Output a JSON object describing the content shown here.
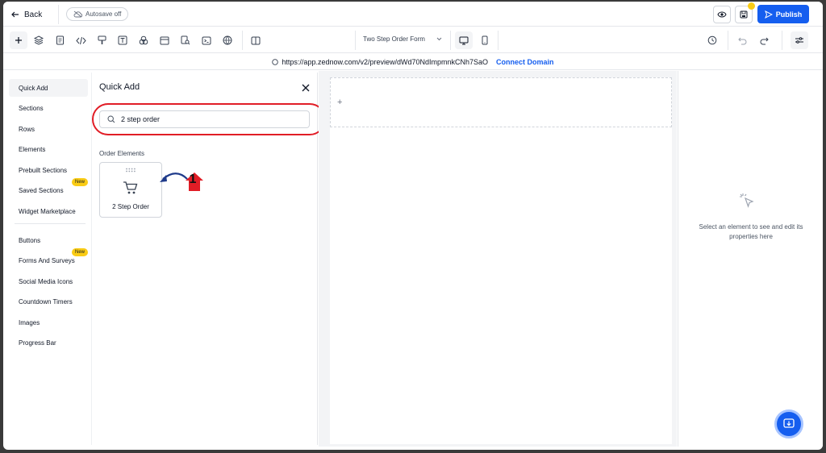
{
  "topbar": {
    "back_label": "Back",
    "autosave_label": "Autosave off",
    "publish_label": "Publish"
  },
  "toolbar": {
    "tools": [
      "plus-icon",
      "layers-icon",
      "page-icon",
      "code-icon",
      "paint-icon",
      "text-icon",
      "shapes-icon",
      "window-icon",
      "search-doc-icon",
      "terminal-icon",
      "globe-icon",
      "split-icon"
    ],
    "page_selector": "Two Step Order Form",
    "devices": [
      "desktop-icon",
      "mobile-icon"
    ]
  },
  "urlbar": {
    "url": "https://app.zednow.com/v2/preview/dWd70NdImpmnkCNh7SaO",
    "connect_label": "Connect Domain"
  },
  "sidebar": {
    "items": [
      {
        "label": "Quick Add",
        "active": true
      },
      {
        "label": "Sections"
      },
      {
        "label": "Rows"
      },
      {
        "label": "Elements"
      },
      {
        "label": "Prebuilt Sections"
      },
      {
        "label": "Saved Sections",
        "badge": "New"
      },
      {
        "label": "Widget Marketplace"
      },
      {
        "label": "Buttons"
      },
      {
        "label": "Forms And Surveys",
        "badge": "New"
      },
      {
        "label": "Social Media Icons"
      },
      {
        "label": "Countdown Timers"
      },
      {
        "label": "Images"
      },
      {
        "label": "Progress Bar"
      }
    ]
  },
  "quick_add": {
    "title": "Quick Add",
    "search_value": "2 step order",
    "section_label": "Order Elements",
    "card_label": "2 Step Order",
    "annotation_number": "1"
  },
  "canvas": {
    "plus": "+"
  },
  "right_panel": {
    "hint": "Select an element to see and edit its properties here"
  },
  "colors": {
    "accent": "#155eef",
    "badge": "#facc15",
    "annotation_red": "#e11d26"
  }
}
